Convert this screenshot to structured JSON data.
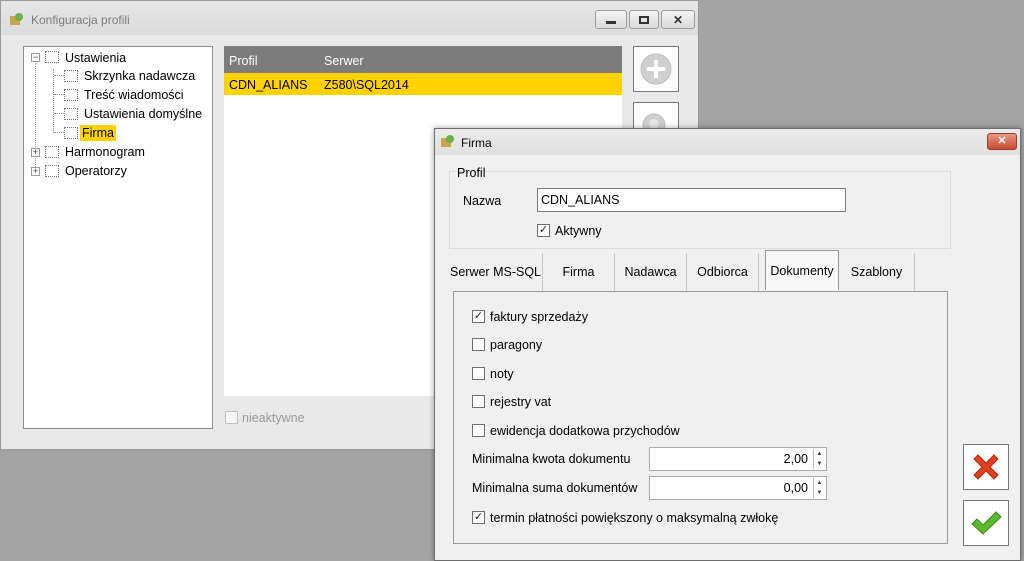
{
  "back_window": {
    "title": "Konfiguracja profili",
    "tree": [
      {
        "label": "Ustawienia",
        "expanded": true
      },
      {
        "label": "Skrzynka nadawcza"
      },
      {
        "label": "Treść wiadomości"
      },
      {
        "label": "Ustawienia domyślne"
      },
      {
        "label": "Firma",
        "selected": true
      },
      {
        "label": "Harmonogram",
        "expanded": false
      },
      {
        "label": "Operatorzy",
        "expanded": false
      }
    ],
    "grid": {
      "columns": [
        "Profil",
        "Serwer"
      ],
      "rows": [
        {
          "profil": "CDN_ALIANS",
          "serwer": "Z580\\SQL2014",
          "selected": true
        }
      ]
    },
    "inactive_label": "nieaktywne"
  },
  "dialog": {
    "title": "Firma",
    "group_title": "Profil",
    "name_label": "Nazwa",
    "name_value": "CDN_ALIANS",
    "active_label": "Aktywny",
    "active_checked": true,
    "tabs": [
      "Serwer MS-SQL",
      "Firma",
      "Nadawca",
      "Odbiorca",
      "Dokumenty",
      "Szablony"
    ],
    "active_tab": "Dokumenty",
    "checkboxes": [
      {
        "label": "faktury sprzedaży",
        "checked": true
      },
      {
        "label": "paragony",
        "checked": false
      },
      {
        "label": "noty",
        "checked": false
      },
      {
        "label": "rejestry vat",
        "checked": false
      },
      {
        "label": "ewidencja dodatkowa przychodów",
        "checked": false
      }
    ],
    "min_amount_label": "Minimalna kwota dokumentu",
    "min_amount_value": "2,00",
    "min_sum_label": "Minimalna suma dokumentów",
    "min_sum_value": "0,00",
    "term_label": "termin płatności powiększony o maksymalną zwłokę",
    "term_checked": true
  },
  "colors": {
    "selection": "#ffd200",
    "grid_header": "#7c7c7c",
    "cancel_icon": "#e04020",
    "ok_icon": "#5cb82e"
  }
}
